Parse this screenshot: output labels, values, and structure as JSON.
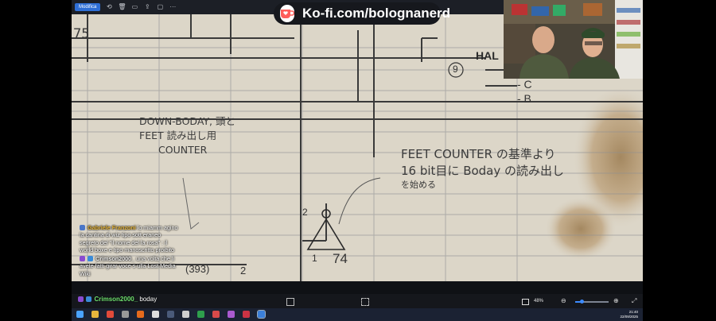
{
  "toolbar": {
    "edit_label": "Modifica",
    "icons": [
      "rotate-icon",
      "delete-icon",
      "print-icon",
      "share-icon",
      "slideshow-icon",
      "more-icon"
    ],
    "more_glyph": "···"
  },
  "kofi": {
    "text": "Ko-fi.com/bolognanerd"
  },
  "document": {
    "left_number": "75",
    "top_right_label": "HAL",
    "circle_number": "9",
    "right_code1": "- C",
    "right_code2": "- B",
    "note_left": [
      "DOWN-BODAY, 頭と",
      "FEET 読み出し用",
      "COUNTER"
    ],
    "note_right": [
      "FEET COUNTER の基準より",
      "16 bit目に Boday の読み出し",
      "を始める"
    ],
    "triangle_top_number": "2",
    "triangle_bottom_left": "1",
    "triangle_bottom_right": "74",
    "bottom_label": "(393)",
    "bottom_label2": "2"
  },
  "chat": {
    "messages": [
      {
        "user": "Gabriele Franzoni",
        "text": " lo miamm agino la cantina di wiz tipo sott eraneo segreto del \"il nome del la rosa\" : il world boxe e tipo manoscritto proibito",
        "badge_color": "#4a76c8"
      },
      {
        "user": "Crimson2000_",
        "text": " una volta che li avete fatti girar voce s ulla Lost Media Wiki",
        "badge_color": "#8a4bd0"
      }
    ],
    "last": {
      "user": "Crimson2000_",
      "text": " boday"
    }
  },
  "viewer": {
    "zoom": "48%",
    "zoom_fraction": 0.18
  },
  "taskbar": {
    "time": "21:40",
    "date": "22/09/2025",
    "apps": [
      {
        "name": "start-icon",
        "color": "#4aa3ff"
      },
      {
        "name": "file-explorer-icon",
        "color": "#e7b53c"
      },
      {
        "name": "chrome-icon",
        "color": "#e04a3a"
      },
      {
        "name": "app-icon-1",
        "color": "#999999"
      },
      {
        "name": "firefox-icon",
        "color": "#e66a1c"
      },
      {
        "name": "obs-icon",
        "color": "#dddddd"
      },
      {
        "name": "steam-icon",
        "color": "#4a5a7a"
      },
      {
        "name": "app-icon-2",
        "color": "#cfcfcf"
      },
      {
        "name": "excel-icon",
        "color": "#2e9e4c"
      },
      {
        "name": "app-icon-3",
        "color": "#d84a4a"
      },
      {
        "name": "app-icon-4",
        "color": "#aa5ad0"
      },
      {
        "name": "app-icon-5",
        "color": "#cc3344"
      },
      {
        "name": "photos-icon",
        "color": "#3b7fd9"
      }
    ]
  }
}
